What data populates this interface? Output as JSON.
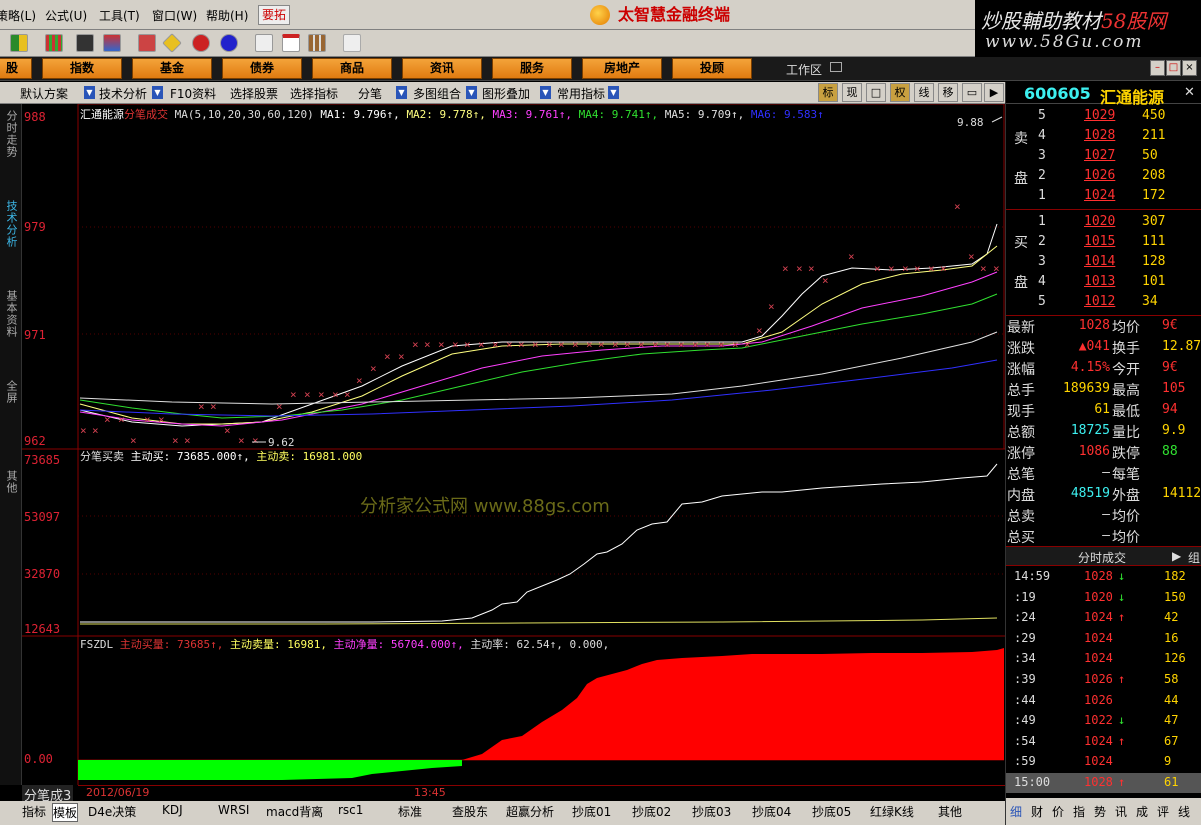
{
  "menubar": {
    "items": [
      "策略(L)",
      "公式(U)",
      "工具(T)",
      "窗口(W)",
      "帮助(H)"
    ],
    "yaotuo": "要拓",
    "brand": "太智慧金融终端"
  },
  "watermark": {
    "line1_a": "炒股輔助教材",
    "line1_b": "58股网",
    "line2": "www.58Gu.com"
  },
  "categories": [
    "股",
    "指数",
    "基金",
    "债券",
    "商品",
    "资讯",
    "服务",
    "房地产",
    "投顾"
  ],
  "workzone": "工作区",
  "optbar": {
    "items": [
      "默认方案",
      "技术分析",
      "F10资料",
      "选择股票",
      "选择指标",
      "分笔",
      "多图组合",
      "图形叠加",
      "常用指标"
    ],
    "right_buttons": [
      "标",
      "现",
      "□",
      "权",
      "线",
      "移",
      "▭",
      "▶"
    ]
  },
  "sidetabs": [
    "分时走势",
    "技术分析",
    "基本资料",
    "全屏",
    "其他"
  ],
  "chart": {
    "panel1_title": {
      "name": "汇通能源",
      "type": "分笔成交",
      "params": "MA(5,10,20,30,60,120)",
      "ma1": "MA1: 9.796↑,",
      "ma2": "MA2: 9.778↑,",
      "ma3": "MA3: 9.761↑,",
      "ma4": "MA4: 9.741↑,",
      "ma5": "MA5: 9.709↑,",
      "ma6": "MA6: 9.583↑"
    },
    "panel1_y": [
      "988",
      "979",
      "971",
      "962"
    ],
    "high_label": "9.88",
    "low_label": "9.62",
    "panel2_title": {
      "name": "分笔买卖",
      "buy": "主动买: 73685.000↑,",
      "sell": "主动卖: 16981.000"
    },
    "panel2_y": [
      "73685",
      "53097",
      "32870",
      "12643"
    ],
    "panel3_title": {
      "name": "FSZDL",
      "a": "主动买量: 73685↑,",
      "b": "主动卖量: 16981,",
      "c": "主动净量: 56704.000↑,",
      "d": "主动率: 62.54↑, 0.000,"
    },
    "panel3_y": [
      "0.00"
    ],
    "center_watermark": "分析家公式网  www.88gs.com",
    "colors": {
      "ma1": "#ffffff",
      "ma2": "#ffff80",
      "ma3": "#ff40ff",
      "ma4": "#30e030",
      "ma5": "#e0e0e0",
      "ma6": "#3030ff",
      "price_x": "#d04050",
      "buy": "#ffffff",
      "sell": "#e0e060",
      "pos_bar": "#ff0000",
      "neg_bar": "#00ff00"
    }
  },
  "bottom": {
    "corner": "分笔成3",
    "date": "2012/06/19",
    "time": "13:45",
    "tabs": [
      "指标",
      "模板",
      "D4e决策",
      "KDJ",
      "WRSI",
      "macd背离",
      "rsc1",
      "标准",
      "查股东",
      "超赢分析",
      "抄底01",
      "抄底02",
      "抄底03",
      "抄底04",
      "抄底05",
      "红绿K线",
      "其他"
    ]
  },
  "quote": {
    "code": "600605",
    "name": "汇通能源",
    "sell_label_1": "卖",
    "sell_label_2": "盘",
    "buy_label_1": "买",
    "buy_label_2": "盘",
    "sells": [
      {
        "lvl": "5",
        "price": "1029",
        "vol": "450"
      },
      {
        "lvl": "4",
        "price": "1028",
        "vol": "211"
      },
      {
        "lvl": "3",
        "price": "1027",
        "vol": "50"
      },
      {
        "lvl": "2",
        "price": "1026",
        "vol": "208"
      },
      {
        "lvl": "1",
        "price": "1024",
        "vol": "172"
      }
    ],
    "buys": [
      {
        "lvl": "1",
        "price": "1020",
        "vol": "307"
      },
      {
        "lvl": "2",
        "price": "1015",
        "vol": "111"
      },
      {
        "lvl": "3",
        "price": "1014",
        "vol": "128"
      },
      {
        "lvl": "4",
        "price": "1013",
        "vol": "101"
      },
      {
        "lvl": "5",
        "price": "1012",
        "vol": "34"
      }
    ],
    "stats": [
      {
        "l1": "最新",
        "v1": "1028",
        "l2": "均价",
        "v2": "9€"
      },
      {
        "l1": "涨跌",
        "v1": "▲041",
        "l2": "换手",
        "v2": "12.87"
      },
      {
        "l1": "涨幅",
        "v1": "4.15%",
        "l2": "今开",
        "v2": "9€"
      },
      {
        "l1": "总手",
        "v1": "189639",
        "l2": "最高",
        "v2": "105"
      },
      {
        "l1": "现手",
        "v1": "61",
        "l2": "最低",
        "v2": "94"
      },
      {
        "l1": "总额",
        "v1": "18725",
        "l2": "量比",
        "v2": "9.9"
      },
      {
        "l1": "涨停",
        "v1": "1086",
        "l2": "跌停",
        "v2": "88"
      },
      {
        "l1": "总笔",
        "v1": "–",
        "l2": "每笔",
        "v2": ""
      },
      {
        "l1": "内盘",
        "v1": "48519",
        "l2": "外盘",
        "v2": "14112"
      },
      {
        "l1": "总卖",
        "v1": "–",
        "l2": "均价",
        "v2": ""
      },
      {
        "l1": "总买",
        "v1": "–",
        "l2": "均价",
        "v2": ""
      }
    ],
    "ticks_header": "分时成交",
    "ticks_header_right": "组",
    "ticks": [
      {
        "t": "14:59",
        "p": "1028",
        "d": "↓",
        "v": "182"
      },
      {
        "t": ":19",
        "p": "1020",
        "d": "↓",
        "v": "150"
      },
      {
        "t": ":24",
        "p": "1024",
        "d": "↑",
        "v": "42"
      },
      {
        "t": ":29",
        "p": "1024",
        "d": "",
        "v": "16"
      },
      {
        "t": ":34",
        "p": "1024",
        "d": "",
        "v": "126"
      },
      {
        "t": ":39",
        "p": "1026",
        "d": "↑",
        "v": "58"
      },
      {
        "t": ":44",
        "p": "1026",
        "d": "",
        "v": "44"
      },
      {
        "t": ":49",
        "p": "1022",
        "d": "↓",
        "v": "47"
      },
      {
        "t": ":54",
        "p": "1024",
        "d": "↑",
        "v": "67"
      },
      {
        "t": ":59",
        "p": "1024",
        "d": "",
        "v": "9"
      },
      {
        "t": "15:00",
        "p": "1028",
        "d": "↑",
        "v": "61"
      }
    ],
    "footer": [
      "细",
      "财",
      "价",
      "指",
      "势",
      "讯",
      "成",
      "评",
      "线"
    ]
  }
}
